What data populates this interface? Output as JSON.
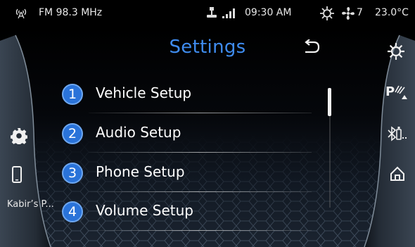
{
  "status": {
    "radio_icon": "radio-antenna-icon",
    "radio": "FM 98.3 MHz",
    "usb_icon": "usb-icon",
    "signal_icon": "signal-bars-icon",
    "time": "09:30 AM",
    "climate_icon": "climate-icon",
    "fan_icon": "fan-icon",
    "fan_level": "7",
    "temperature": "23.0°C"
  },
  "header": {
    "title": "Settings",
    "back_icon": "back-arrow-icon"
  },
  "menu": [
    {
      "number": "1",
      "label": "Vehicle Setup"
    },
    {
      "number": "2",
      "label": "Audio Setup"
    },
    {
      "number": "3",
      "label": "Phone Setup"
    },
    {
      "number": "4",
      "label": "Volume Setup"
    }
  ],
  "left_nav": {
    "settings_icon": "gear-icon",
    "phone_icon": "phone-icon",
    "device_name": "Kabir’s P..."
  },
  "right_nav": {
    "climate_icon": "climate-icon",
    "parking_icon": "parking-sensor-icon",
    "bluetooth_icon": "bluetooth-device-icon",
    "home_icon": "home-icon"
  },
  "colors": {
    "accent": "#3f8cf0",
    "badge": "#2a73d9",
    "background": "#000000"
  }
}
